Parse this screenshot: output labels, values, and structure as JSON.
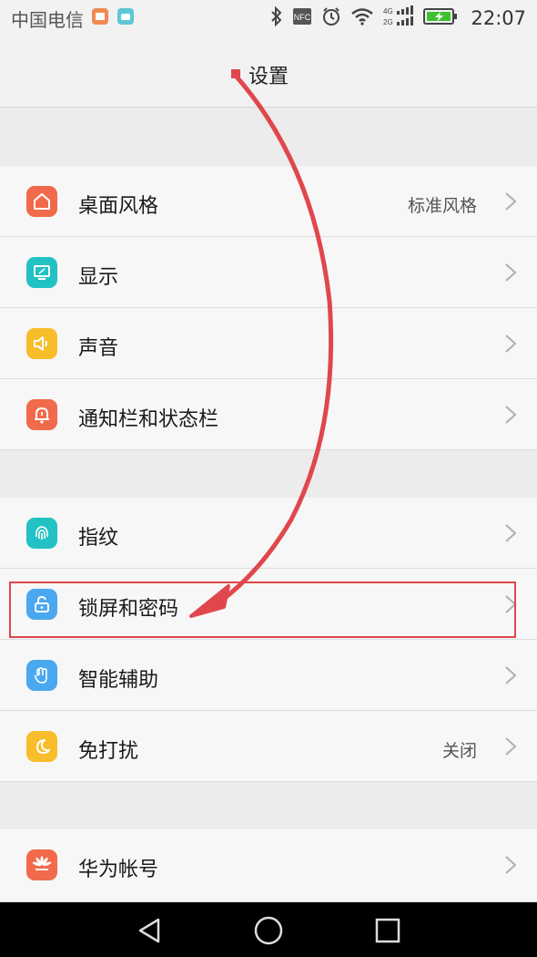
{
  "status_bar": {
    "carrier": "中国电信",
    "time": "22:07",
    "nfc": "NFC",
    "net_4g": "4G",
    "net_2g": "2G",
    "battery_color": "#3ec12f"
  },
  "header": {
    "title": "设置"
  },
  "settings": {
    "items": [
      {
        "label": "桌面风格",
        "value": "标准风格",
        "icon": "home-icon",
        "color": "#f16a4c"
      },
      {
        "label": "显示",
        "value": "",
        "icon": "display-icon",
        "color": "#22c1c3"
      },
      {
        "label": "声音",
        "value": "",
        "icon": "sound-icon",
        "color": "#f7bd2a"
      },
      {
        "label": "通知栏和状态栏",
        "value": "",
        "icon": "notification-bell-icon",
        "color": "#f16a4c"
      },
      {
        "label": "指纹",
        "value": "",
        "icon": "fingerprint-icon",
        "color": "#22c1c3"
      },
      {
        "label": "锁屏和密码",
        "value": "",
        "icon": "unlock-icon",
        "color": "#4aa8f0"
      },
      {
        "label": "智能辅助",
        "value": "",
        "icon": "hand-icon",
        "color": "#4aa8f0"
      },
      {
        "label": "免打扰",
        "value": "关闭",
        "icon": "moon-icon",
        "color": "#f7bd2a"
      },
      {
        "label": "华为帐号",
        "value": "",
        "icon": "huawei-icon",
        "color": "#f16a4c"
      }
    ],
    "highlighted_item": "锁屏和密码"
  },
  "annotation": {
    "color": "#e0474c"
  },
  "nav_bar": {
    "buttons": [
      "back-icon",
      "home-circle-icon",
      "recents-icon"
    ]
  }
}
